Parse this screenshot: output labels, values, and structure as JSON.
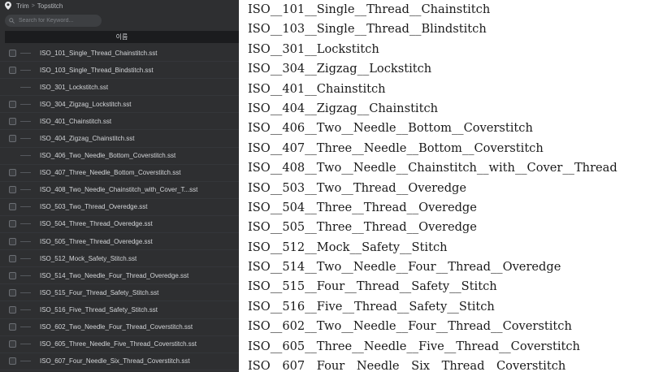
{
  "breadcrumb": {
    "root": "Trim",
    "separator": ">",
    "current": "Topstitch"
  },
  "search": {
    "placeholder": "Search for Keyword..."
  },
  "table": {
    "column_header": "이름"
  },
  "files": [
    {
      "name": "ISO_101_Single_Thread_Chainstitch.sst",
      "checkbox": true
    },
    {
      "name": "ISO_103_Single_Thread_Bindstitch.sst",
      "checkbox": true
    },
    {
      "name": "ISO_301_Lockstitch.sst",
      "checkbox": false
    },
    {
      "name": "ISO_304_Zigzag_Lockstitch.sst",
      "checkbox": true
    },
    {
      "name": "ISO_401_Chainstitch.sst",
      "checkbox": true
    },
    {
      "name": "ISO_404_Zigzag_Chainstitch.sst",
      "checkbox": true
    },
    {
      "name": "ISO_406_Two_Needle_Bottom_Coverstitch.sst",
      "checkbox": false
    },
    {
      "name": "ISO_407_Three_Needle_Bottom_Coverstitch.sst",
      "checkbox": true
    },
    {
      "name": "ISO_408_Two_Needle_Chainstitch_with_Cover_T...sst",
      "checkbox": true
    },
    {
      "name": "ISO_503_Two_Thread_Overedge.sst",
      "checkbox": true
    },
    {
      "name": "ISO_504_Three_Thread_Overedge.sst",
      "checkbox": true
    },
    {
      "name": "ISO_505_Three_Thread_Overedge.sst",
      "checkbox": true
    },
    {
      "name": "ISO_512_Mock_Safety_Stitch.sst",
      "checkbox": true
    },
    {
      "name": "ISO_514_Two_Needle_Four_Thread_Overedge.sst",
      "checkbox": true
    },
    {
      "name": "ISO_515_Four_Thread_Safety_Stitch.sst",
      "checkbox": true
    },
    {
      "name": "ISO_516_Five_Thread_Safety_Stitch.sst",
      "checkbox": true
    },
    {
      "name": "ISO_602_Two_Needle_Four_Thread_Coverstitch.sst",
      "checkbox": true
    },
    {
      "name": "ISO_605_Three_Needle_Five_Thread_Coverstitch.sst",
      "checkbox": true
    },
    {
      "name": "ISO_607_Four_Needle_Six_Thread_Coverstitch.sst",
      "checkbox": true
    }
  ],
  "names": [
    "ISO__101__Single__Thread__Chainstitch",
    "ISO__103__Single__Thread__Blindstitch",
    "ISO__301__Lockstitch",
    "ISO__304__Zigzag__Lockstitch",
    "ISO__401__Chainstitch",
    "ISO__404__Zigzag__Chainstitch",
    "ISO__406__Two__Needle__Bottom__Coverstitch",
    "ISO__407__Three__Needle__Bottom__Coverstitch",
    "ISO__408__Two__Needle__Chainstitch__with__Cover__Thread",
    "ISO__503__Two__Thread__Overedge",
    "ISO__504__Three__Thread__Overedge",
    "ISO__505__Three__Thread__Overedge",
    "ISO__512__Mock__Safety__Stitch",
    "ISO__514__Two__Needle__Four__Thread__Overedge",
    "ISO__515__Four__Thread__Safety__Stitch",
    "ISO__516__Five__Thread__Safety__Stitch",
    "ISO__602__Two__Needle__Four__Thread__Coverstitch",
    "ISO__605__Three__Needle__Five__Thread__Coverstitch",
    "ISO__607__Four__Needle__Six__Thread__Coverstitch"
  ],
  "icons": {
    "location": "map-pin-icon",
    "search": "search-icon"
  },
  "colors": {
    "panel_bg": "#2e2f31",
    "header_bg": "#1b1c1e",
    "text_light": "#d3d5d8",
    "text_dark": "#1a1a1a"
  }
}
